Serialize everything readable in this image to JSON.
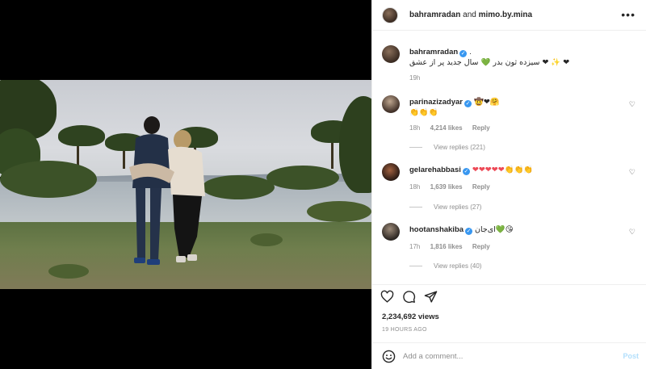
{
  "header": {
    "author": "bahramradan",
    "joiner": "and",
    "coauthor": "mimo.by.mina",
    "more": "•••"
  },
  "caption": {
    "user": "bahramradan",
    "suffix": ".",
    "text": "❤ ✨ ❤ سیزده ثون بدر 💚 سال جدید پر از عشق",
    "time": "19h"
  },
  "comments": [
    {
      "user": "parinazizadyar",
      "text": "🤠❤🤗",
      "line2": "👏👏👏",
      "time": "18h",
      "likes": "4,214 likes",
      "reply": "Reply",
      "replies": "View replies (221)"
    },
    {
      "user": "gelarehabbasi",
      "text": "❤❤❤❤❤👏👏👏",
      "time": "18h",
      "likes": "1,639 likes",
      "reply": "Reply",
      "replies": "View replies (27)"
    },
    {
      "user": "hootanshakiba",
      "text": "ای‌جان💚😘",
      "time": "17h",
      "likes": "1,816 likes",
      "reply": "Reply",
      "replies": "View replies (40)"
    }
  ],
  "views": "2,234,692 views",
  "posted": "19 HOURS AGO",
  "add_comment": {
    "placeholder": "Add a comment...",
    "post": "Post"
  },
  "icons": [
    "heart-icon",
    "comment-icon",
    "share-icon",
    "more-icon",
    "smile-icon",
    "verified-icon"
  ],
  "colors": {
    "verified": "#3897f0",
    "post": "#b2dffc",
    "muted": "#8e8e8e"
  }
}
